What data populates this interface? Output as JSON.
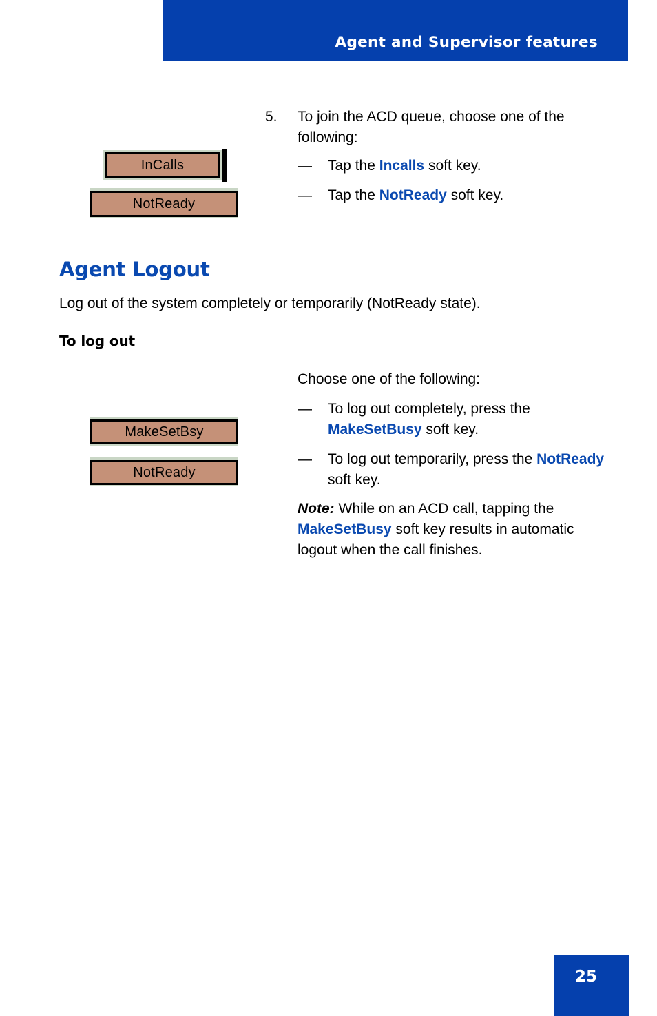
{
  "header": {
    "title": "Agent and Supervisor features",
    "background_color": "#0540AD",
    "text_color": "#FFFFFF"
  },
  "accent_color": "#0A49B0",
  "softkey_style": {
    "cap_color": "#C59178",
    "frame_color": "#C9D6C5",
    "border_color": "#000000"
  },
  "step5": {
    "number": "5.",
    "text": "To join the ACD queue, choose one of the following:",
    "bullets": [
      {
        "dash": "—",
        "prefix": "Tap the ",
        "keyword": "Incalls",
        "suffix": " soft key."
      },
      {
        "dash": "—",
        "prefix": "Tap the ",
        "keyword": "NotReady",
        "suffix": " soft key."
      }
    ]
  },
  "softkeys_top": [
    {
      "label": "InCalls"
    },
    {
      "label": "NotReady"
    }
  ],
  "section": {
    "heading": "Agent Logout",
    "intro": "Log out of the system completely or temporarily (NotReady state).",
    "subheading": "To log out"
  },
  "logout": {
    "lead": "Choose one of the following:",
    "bullets": [
      {
        "dash": "—",
        "prefix": "To log out completely, press the ",
        "keyword": "MakeSetBusy",
        "suffix": " soft key."
      },
      {
        "dash": "—",
        "prefix": "To log out temporarily, press the ",
        "keyword": "NotReady",
        "suffix": " soft key."
      }
    ],
    "note": {
      "label": "Note:",
      "prefix": " While on an ACD call, tapping the ",
      "keyword": "MakeSetBusy",
      "suffix": " soft key results in automatic logout when the call finishes."
    }
  },
  "softkeys_bottom": [
    {
      "label": "MakeSetBsy"
    },
    {
      "label": "NotReady"
    }
  ],
  "footer": {
    "page_number": "25"
  }
}
